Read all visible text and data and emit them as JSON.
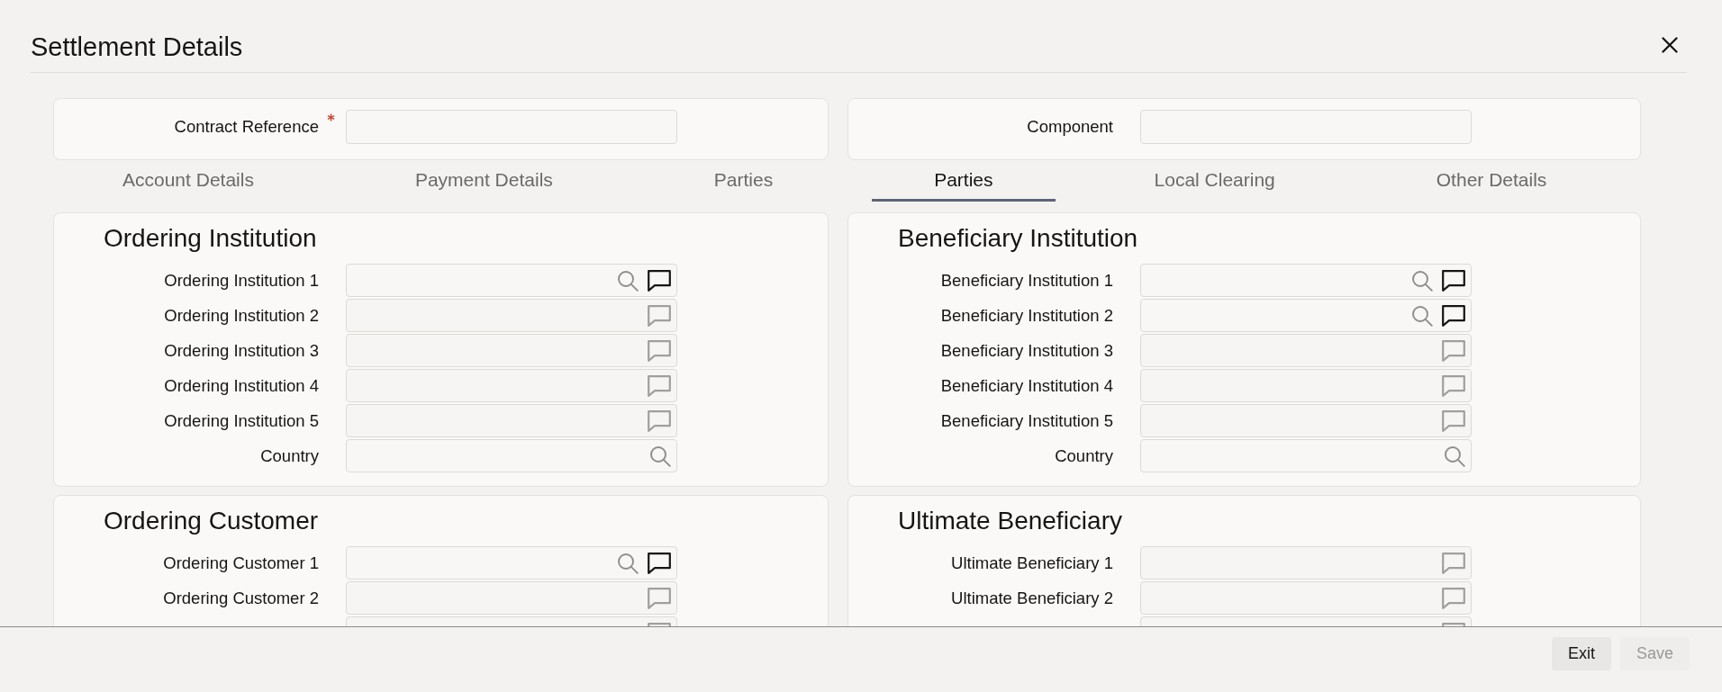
{
  "window": {
    "title": "Settlement Details"
  },
  "header_fields": [
    {
      "label": "Contract Reference",
      "required": true
    },
    {
      "label": "Component",
      "required": false
    }
  ],
  "tabs": [
    {
      "label": "Account Details",
      "selected": false
    },
    {
      "label": "Payment Details",
      "selected": false
    },
    {
      "label": "Parties",
      "selected": false
    },
    {
      "label": "Parties",
      "selected": true
    },
    {
      "label": "Local Clearing",
      "selected": false
    },
    {
      "label": "Other Details",
      "selected": false
    }
  ],
  "panels": [
    {
      "title": "Ordering Institution",
      "fields": [
        {
          "label": "Ordering Institution 1",
          "search": true,
          "comment": true,
          "disabled": false
        },
        {
          "label": "Ordering Institution 2",
          "search": false,
          "comment": true,
          "disabled": true
        },
        {
          "label": "Ordering Institution 3",
          "search": false,
          "comment": true,
          "disabled": true
        },
        {
          "label": "Ordering Institution 4",
          "search": false,
          "comment": true,
          "disabled": true
        },
        {
          "label": "Ordering Institution 5",
          "search": false,
          "comment": true,
          "disabled": true
        },
        {
          "label": "Country",
          "search": true,
          "comment": false,
          "disabled": false
        }
      ]
    },
    {
      "title": "Beneficiary Institution",
      "fields": [
        {
          "label": "Beneficiary Institution 1",
          "search": true,
          "comment": true,
          "disabled": false
        },
        {
          "label": "Beneficiary Institution 2",
          "search": true,
          "comment": true,
          "disabled": false
        },
        {
          "label": "Beneficiary Institution 3",
          "search": false,
          "comment": true,
          "disabled": true
        },
        {
          "label": "Beneficiary Institution 4",
          "search": false,
          "comment": true,
          "disabled": true
        },
        {
          "label": "Beneficiary Institution 5",
          "search": false,
          "comment": true,
          "disabled": true
        },
        {
          "label": "Country",
          "search": true,
          "comment": false,
          "disabled": false
        }
      ]
    },
    {
      "title": "Ordering Customer",
      "fields": [
        {
          "label": "Ordering Customer 1",
          "search": true,
          "comment": true,
          "disabled": false
        },
        {
          "label": "Ordering Customer 2",
          "search": false,
          "comment": true,
          "disabled": true
        },
        {
          "search": false,
          "comment": true,
          "disabled": true
        }
      ]
    },
    {
      "title": "Ultimate Beneficiary",
      "fields": [
        {
          "label": "Ultimate Beneficiary 1",
          "search": false,
          "comment": true,
          "disabled": true
        },
        {
          "label": "Ultimate Beneficiary 2",
          "search": false,
          "comment": true,
          "disabled": true
        },
        {
          "search": false,
          "comment": true,
          "disabled": true
        }
      ]
    }
  ],
  "buttons": [
    {
      "label": "Exit",
      "disabled": false
    },
    {
      "label": "Save",
      "disabled": true
    }
  ]
}
